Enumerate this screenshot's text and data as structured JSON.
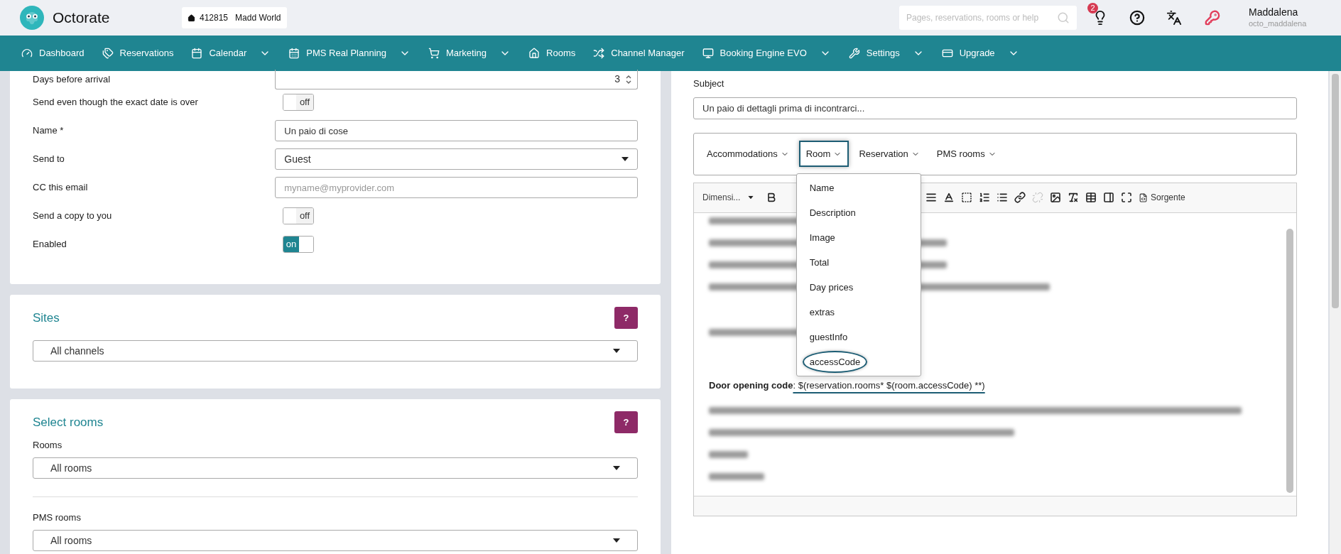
{
  "header": {
    "app_name": "Octorate",
    "property": {
      "id": "412815",
      "name": "Madd World"
    },
    "search": {
      "placeholder": "Pages, reservations, rooms or help"
    },
    "notifications_badge": "2",
    "user": {
      "name": "Maddalena",
      "username": "octo_maddalena"
    }
  },
  "nav": [
    {
      "label": "Dashboard",
      "dropdown": false
    },
    {
      "label": "Reservations",
      "dropdown": false
    },
    {
      "label": "Calendar",
      "dropdown": true
    },
    {
      "label": "PMS Real Planning",
      "dropdown": true
    },
    {
      "label": "Marketing",
      "dropdown": true
    },
    {
      "label": "Rooms",
      "dropdown": false
    },
    {
      "label": "Channel Manager",
      "dropdown": false
    },
    {
      "label": "Booking Engine EVO",
      "dropdown": true
    },
    {
      "label": "Settings",
      "dropdown": true
    },
    {
      "label": "Upgrade",
      "dropdown": true
    }
  ],
  "form": {
    "fields": [
      {
        "kind": "number",
        "label": "Days before arrival",
        "value": "3"
      },
      {
        "kind": "toggle",
        "label": "Send even though the exact date is over",
        "on": false,
        "text": "off"
      },
      {
        "kind": "text",
        "label": "Name *",
        "value": "Un paio di cose"
      },
      {
        "kind": "select",
        "label": "Send to",
        "value": "Guest"
      },
      {
        "kind": "text",
        "label": "CC this email",
        "placeholder": "myname@myprovider.com"
      },
      {
        "kind": "toggle",
        "label": "Send a copy to you",
        "on": false,
        "text": "off"
      },
      {
        "kind": "toggle",
        "label": "Enabled",
        "on": true,
        "text": "on"
      }
    ]
  },
  "sites": {
    "title": "Sites",
    "help": "?",
    "value": "All channels"
  },
  "select_rooms": {
    "title": "Select rooms",
    "help": "?",
    "groups": [
      {
        "label": "Rooms",
        "value": "All rooms"
      },
      {
        "label": "PMS rooms",
        "value": "All rooms"
      }
    ]
  },
  "email": {
    "subject_label": "Subject",
    "subject": "Un paio di dettagli prima di incontrarci...",
    "variables": [
      {
        "label": "Accommodations",
        "selected": false
      },
      {
        "label": "Room",
        "selected": true
      },
      {
        "label": "Reservation",
        "selected": false
      },
      {
        "label": "PMS rooms",
        "selected": false
      }
    ],
    "menu": [
      {
        "label": "Name",
        "selected": false
      },
      {
        "label": "Description",
        "selected": false
      },
      {
        "label": "Image",
        "selected": false
      },
      {
        "label": "Total",
        "selected": false
      },
      {
        "label": "Day prices",
        "selected": false
      },
      {
        "label": "extras",
        "selected": false
      },
      {
        "label": "guestInfo",
        "selected": false
      },
      {
        "label": "accessCode",
        "selected": true
      }
    ],
    "toolbar": {
      "format": "Dimensi...",
      "source": "Sorgente",
      "buttons": [
        {
          "disabled": false
        },
        {
          "disabled": false
        },
        {
          "disabled": false
        },
        {
          "disabled": false
        },
        {
          "disabled": false
        },
        {
          "disabled": false
        },
        {
          "disabled": false
        },
        {
          "disabled": true
        },
        {
          "disabled": false
        },
        {
          "disabled": false
        },
        {
          "disabled": false
        },
        {
          "disabled": false
        },
        {
          "disabled": false
        }
      ]
    },
    "body": [
      {
        "kind": "blurred"
      },
      {
        "kind": "blurred"
      },
      {
        "kind": "blurred"
      },
      {
        "kind": "blurred"
      },
      {
        "kind": "blurred"
      },
      {
        "kind": "code",
        "label": "Door opening code",
        "text": ": $(reservation.rooms* $(room.accessCode) **)",
        "highlighted": true
      },
      {
        "kind": "blurred"
      },
      {
        "kind": "blurred"
      },
      {
        "kind": "blurred"
      },
      {
        "kind": "blurred"
      }
    ]
  }
}
